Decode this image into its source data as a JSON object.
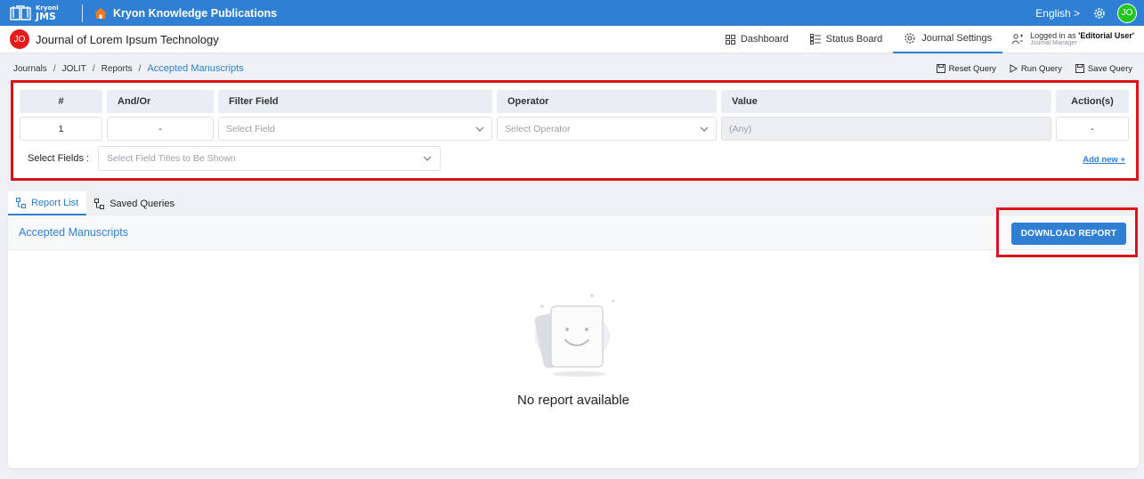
{
  "topbar": {
    "logo_small": "Kryoni",
    "logo_big": "JMS",
    "publisher": "Kryon Knowledge Publications",
    "language": "English >",
    "user_initials": "JO",
    "bg_color": "#2f7fd5"
  },
  "journal": {
    "initials": "JO",
    "title": "Journal of Lorem Ipsum Technology",
    "nav": [
      {
        "label": "Dashboard",
        "icon": "grid-icon"
      },
      {
        "label": "Status Board",
        "icon": "list-board-icon"
      },
      {
        "label": "Journal Settings",
        "icon": "settings-icon"
      }
    ],
    "login_prefix": "Logged in as",
    "login_role": "'Editorial User'",
    "login_subrole": "Journal Manager"
  },
  "breadcrumb": {
    "items": [
      "Journals",
      "JOLIT",
      "Reports"
    ],
    "current": "Accepted Manuscripts"
  },
  "query_actions": {
    "reset": "Reset Query",
    "run": "Run Query",
    "save": "Save Query"
  },
  "filter": {
    "headers": [
      "#",
      "And/Or",
      "Filter Field",
      "Operator",
      "Value",
      "Action(s)"
    ],
    "row": {
      "num": "1",
      "and_or": "-",
      "field_placeholder": "Select Field",
      "operator_placeholder": "Select Operator",
      "value_placeholder": "(Any)",
      "action": "-"
    },
    "select_fields_label": "Select Fields :",
    "select_fields_placeholder": "Select Field Titles to Be Shown",
    "add_new": "Add new +"
  },
  "tabs": [
    {
      "label": "Report List",
      "active": true
    },
    {
      "label": "Saved Queries",
      "active": false
    }
  ],
  "report": {
    "title": "Accepted Manuscripts",
    "download_label": "DOWNLOAD REPORT",
    "empty_text": "No report available"
  }
}
